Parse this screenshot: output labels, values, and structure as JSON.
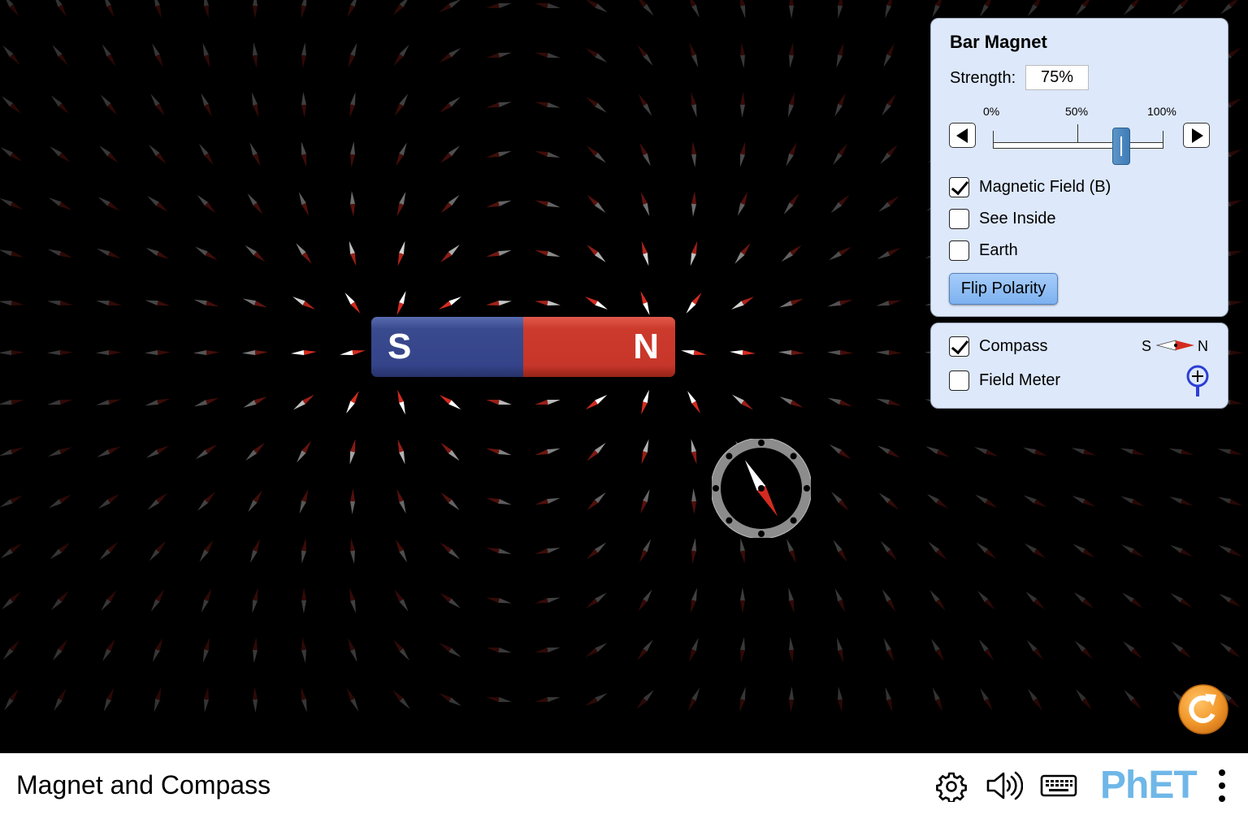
{
  "app": {
    "title": "Magnet and Compass"
  },
  "magnet": {
    "south_label": "S",
    "north_label": "N",
    "colors": {
      "south": "#35448a",
      "north": "#c7362a"
    }
  },
  "bar_magnet_panel": {
    "title": "Bar Magnet",
    "strength_label": "Strength:",
    "strength_value": "75%",
    "strength_fraction": 0.75,
    "slider_ticks": [
      "0%",
      "50%",
      "100%"
    ],
    "checkboxes": [
      {
        "label": "Magnetic Field (B)",
        "checked": true
      },
      {
        "label": "See Inside",
        "checked": false
      },
      {
        "label": "Earth",
        "checked": false
      }
    ],
    "flip_button_label": "Flip Polarity"
  },
  "tools_panel": {
    "checkboxes": [
      {
        "label": "Compass",
        "checked": true
      },
      {
        "label": "Field Meter",
        "checked": false
      }
    ],
    "compass_legend": {
      "south": "S",
      "north": "N"
    }
  },
  "navbar": {
    "icons": [
      "gear-icon",
      "sound-icon",
      "keyboard-icon",
      "phet-logo",
      "menu-icon"
    ],
    "logo_text": "PhET"
  },
  "colors": {
    "panel_background": "#dde8fb",
    "button_blue": "#7cb1ef",
    "reset_orange": "#f39a2c",
    "phet_blue": "#6fb7e8"
  }
}
